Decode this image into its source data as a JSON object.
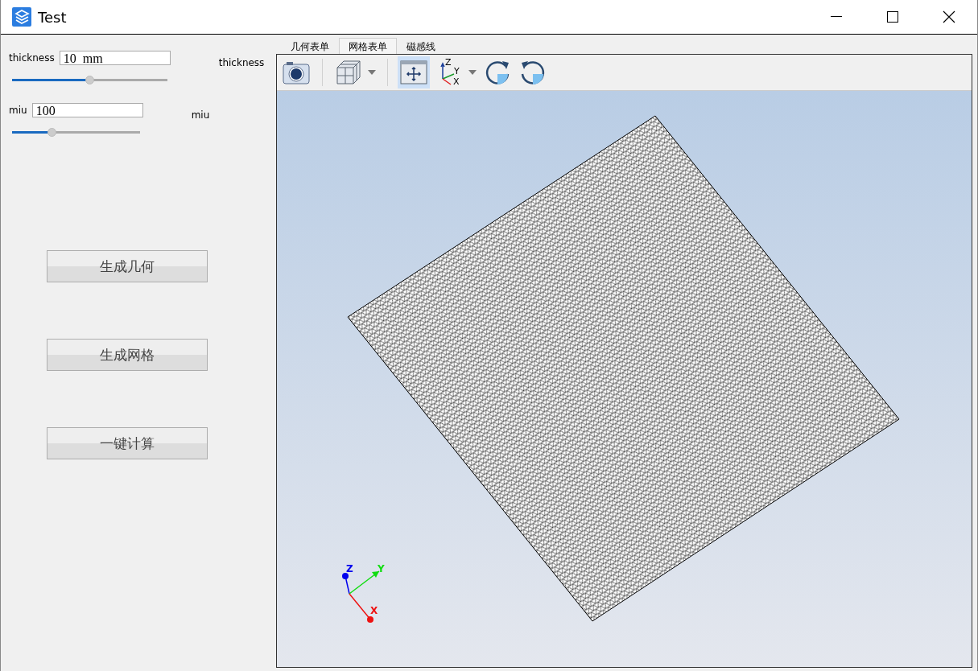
{
  "window": {
    "title": "Test"
  },
  "parameters": [
    {
      "label": "thickness",
      "value": "10  mm",
      "level": 0.5,
      "side_label": "thickness"
    },
    {
      "label": "miu",
      "value": "100",
      "level": 0.31,
      "side_label": "miu"
    }
  ],
  "actions": [
    "生成几何",
    "生成网格",
    "一键计算"
  ],
  "tabs": [
    {
      "label": "几何表单",
      "selected": false
    },
    {
      "label": "网格表单",
      "selected": true
    },
    {
      "label": "磁感线",
      "selected": false
    }
  ],
  "toolbar": [
    {
      "kind": "camera",
      "selected": false
    },
    {
      "kind": "separator"
    },
    {
      "kind": "cube",
      "selected": false
    },
    {
      "kind": "separator"
    },
    {
      "kind": "fit",
      "selected": true
    },
    {
      "kind": "axes",
      "selected": false,
      "labels": [
        "Z",
        "Y",
        "X"
      ]
    },
    {
      "kind": "rotate-cw",
      "selected": false
    },
    {
      "kind": "rotate-ccw",
      "selected": false
    }
  ],
  "triad": {
    "labels": [
      "Z",
      "Y",
      "X"
    ]
  }
}
